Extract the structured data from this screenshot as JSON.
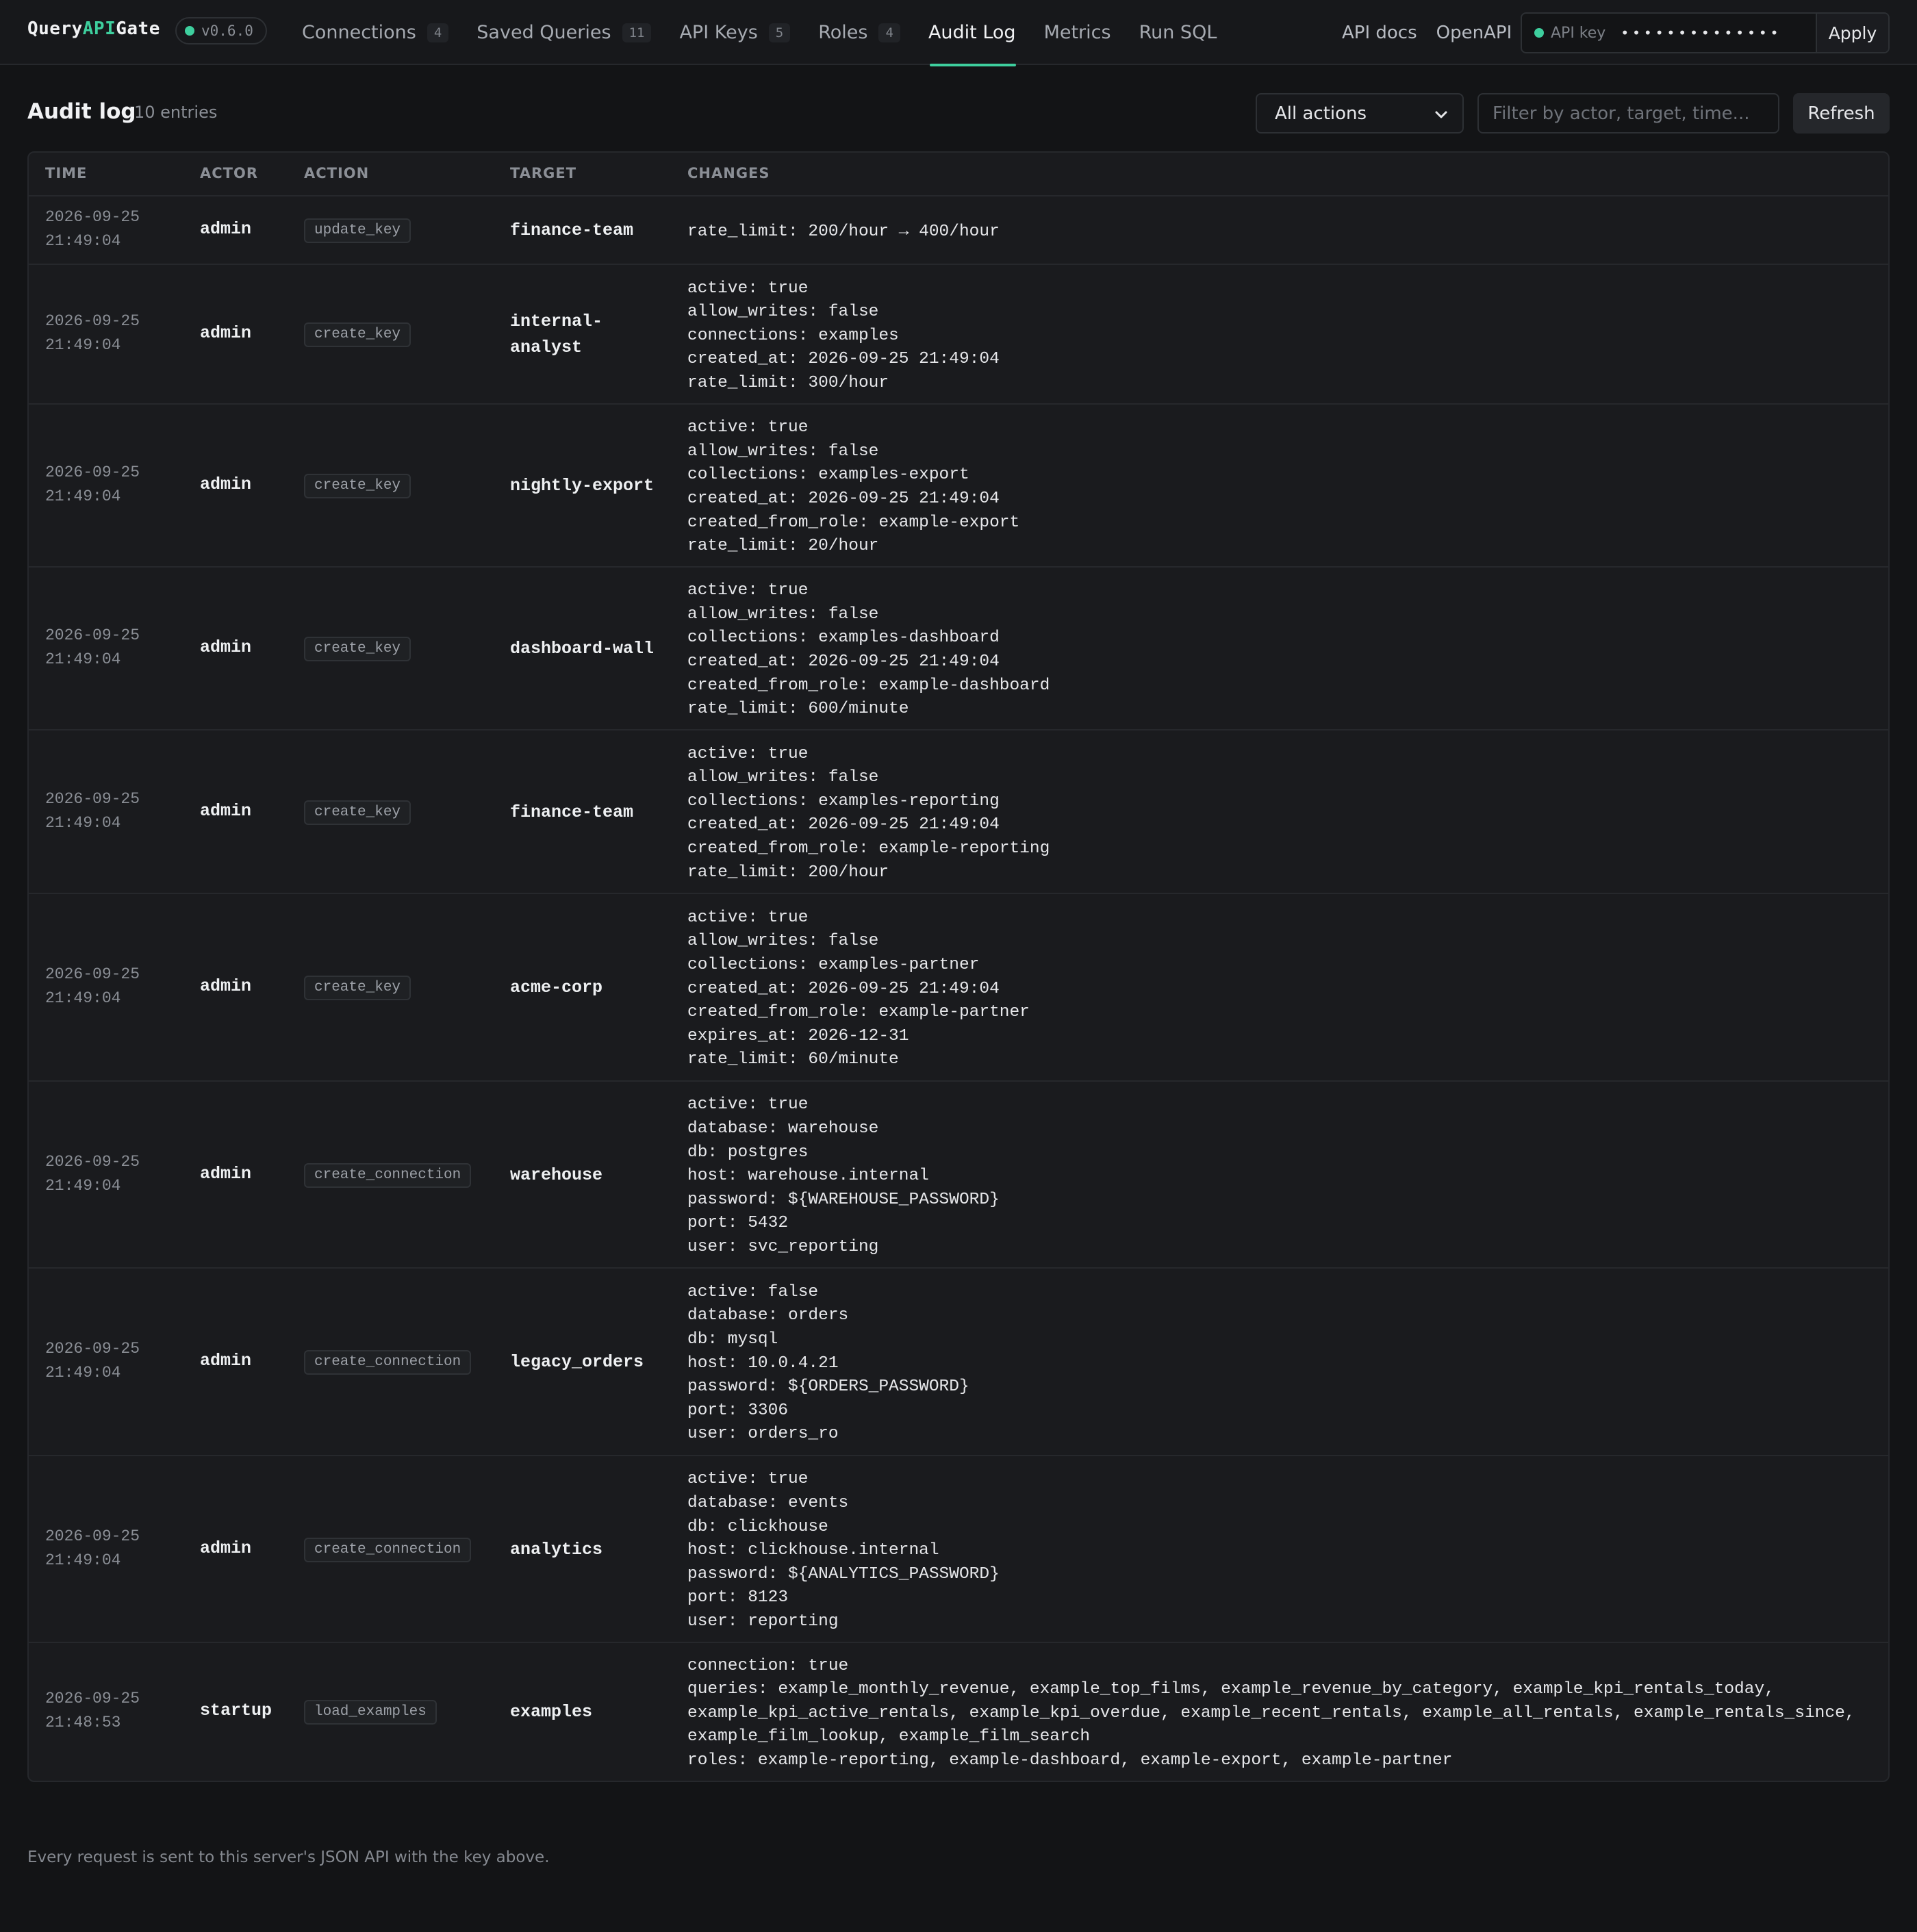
{
  "app": {
    "name_part1": "Query",
    "name_part2": "API",
    "name_part3": "Gate",
    "version": "v0.6.0"
  },
  "nav": {
    "tabs": [
      {
        "label": "Connections",
        "count": "4"
      },
      {
        "label": "Saved Queries",
        "count": "11"
      },
      {
        "label": "API Keys",
        "count": "5"
      },
      {
        "label": "Roles",
        "count": "4"
      },
      {
        "label": "Audit Log",
        "active": true
      },
      {
        "label": "Metrics"
      },
      {
        "label": "Run SQL"
      }
    ],
    "links": {
      "api_docs": "API docs",
      "openapi": "OpenAPI"
    },
    "api_key": {
      "label": "API key",
      "value": "••••••••••••••",
      "apply": "Apply"
    }
  },
  "page": {
    "title": "Audit log",
    "entry_count": "10 entries",
    "action_filter": "All actions",
    "search_placeholder": "Filter by actor, target, time...",
    "refresh": "Refresh"
  },
  "table": {
    "columns": [
      "TIME",
      "ACTOR",
      "ACTION",
      "TARGET",
      "CHANGES"
    ],
    "rows": [
      {
        "date": "2026-09-25",
        "time": "21:49:04",
        "actor": "admin",
        "action": "update_key",
        "target": "finance-team",
        "changes": [
          "rate_limit: 200/hour → 400/hour"
        ]
      },
      {
        "date": "2026-09-25",
        "time": "21:49:04",
        "actor": "admin",
        "action": "create_key",
        "target": "internal-analyst",
        "changes": [
          "active: true",
          "allow_writes: false",
          "connections: examples",
          "created_at: 2026-09-25 21:49:04",
          "rate_limit: 300/hour"
        ]
      },
      {
        "date": "2026-09-25",
        "time": "21:49:04",
        "actor": "admin",
        "action": "create_key",
        "target": "nightly-export",
        "changes": [
          "active: true",
          "allow_writes: false",
          "collections: examples-export",
          "created_at: 2026-09-25 21:49:04",
          "created_from_role: example-export",
          "rate_limit: 20/hour"
        ]
      },
      {
        "date": "2026-09-25",
        "time": "21:49:04",
        "actor": "admin",
        "action": "create_key",
        "target": "dashboard-wall",
        "changes": [
          "active: true",
          "allow_writes: false",
          "collections: examples-dashboard",
          "created_at: 2026-09-25 21:49:04",
          "created_from_role: example-dashboard",
          "rate_limit: 600/minute"
        ]
      },
      {
        "date": "2026-09-25",
        "time": "21:49:04",
        "actor": "admin",
        "action": "create_key",
        "target": "finance-team",
        "changes": [
          "active: true",
          "allow_writes: false",
          "collections: examples-reporting",
          "created_at: 2026-09-25 21:49:04",
          "created_from_role: example-reporting",
          "rate_limit: 200/hour"
        ]
      },
      {
        "date": "2026-09-25",
        "time": "21:49:04",
        "actor": "admin",
        "action": "create_key",
        "target": "acme-corp",
        "changes": [
          "active: true",
          "allow_writes: false",
          "collections: examples-partner",
          "created_at: 2026-09-25 21:49:04",
          "created_from_role: example-partner",
          "expires_at: 2026-12-31",
          "rate_limit: 60/minute"
        ]
      },
      {
        "date": "2026-09-25",
        "time": "21:49:04",
        "actor": "admin",
        "action": "create_connection",
        "target": "warehouse",
        "changes": [
          "active: true",
          "database: warehouse",
          "db: postgres",
          "host: warehouse.internal",
          "password: ${WAREHOUSE_PASSWORD}",
          "port: 5432",
          "user: svc_reporting"
        ]
      },
      {
        "date": "2026-09-25",
        "time": "21:49:04",
        "actor": "admin",
        "action": "create_connection",
        "target": "legacy_orders",
        "changes": [
          "active: false",
          "database: orders",
          "db: mysql",
          "host: 10.0.4.21",
          "password: ${ORDERS_PASSWORD}",
          "port: 3306",
          "user: orders_ro"
        ]
      },
      {
        "date": "2026-09-25",
        "time": "21:49:04",
        "actor": "admin",
        "action": "create_connection",
        "target": "analytics",
        "changes": [
          "active: true",
          "database: events",
          "db: clickhouse",
          "host: clickhouse.internal",
          "password: ${ANALYTICS_PASSWORD}",
          "port: 8123",
          "user: reporting"
        ]
      },
      {
        "date": "2026-09-25",
        "time": "21:48:53",
        "actor": "startup",
        "action": "load_examples",
        "target": "examples",
        "changes": [
          "connection: true",
          "queries: example_monthly_revenue, example_top_films, example_revenue_by_category, example_kpi_rentals_today, example_kpi_active_rentals, example_kpi_overdue, example_recent_rentals, example_all_rentals, example_rentals_since, example_film_lookup, example_film_search",
          "roles: example-reporting, example-dashboard, example-export, example-partner"
        ]
      }
    ]
  },
  "footer": {
    "note": "Every request is sent to this server's JSON API with the key above."
  },
  "colors": {
    "accent": "#3ecf9e",
    "background": "#131416",
    "panel": "#1a1b1e"
  }
}
